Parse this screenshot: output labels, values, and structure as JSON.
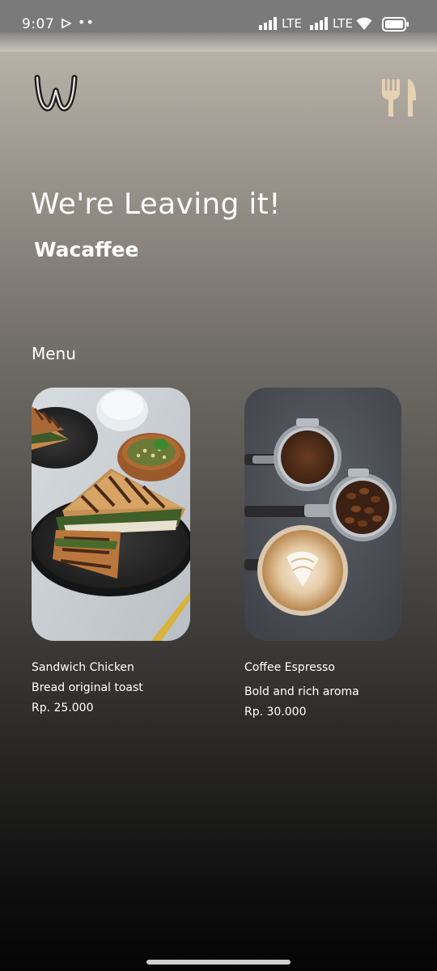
{
  "status_bar": {
    "time": "9:07",
    "dots": "••",
    "network_1": "LTE",
    "network_2": "LTE"
  },
  "header": {
    "logo_icon": "w-logo-icon",
    "menu_icon": "fork-knife-icon",
    "headline": "We're Leaving it!",
    "brand": "Wacaffee"
  },
  "menu": {
    "title": "Menu",
    "items": [
      {
        "name": "Sandwich Chicken",
        "description": "Bread original toast",
        "price": "Rp. 25.000",
        "image_icon": "sandwich-photo"
      },
      {
        "name": "Coffee Espresso",
        "description": "Bold and rich aroma",
        "price": "Rp. 30.000",
        "image_icon": "coffee-photo"
      }
    ]
  },
  "colors": {
    "icon_accent": "#e6d2b4",
    "text": "#ffffff"
  }
}
